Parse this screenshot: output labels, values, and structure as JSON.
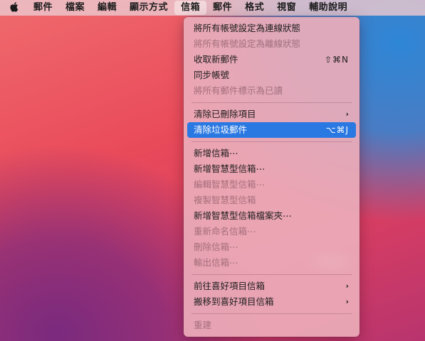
{
  "menubar": {
    "apple_icon": "apple-logo",
    "items": [
      {
        "label": "郵件"
      },
      {
        "label": "檔案"
      },
      {
        "label": "編輯"
      },
      {
        "label": "顯示方式"
      },
      {
        "label": "信箱",
        "active": true
      },
      {
        "label": "郵件"
      },
      {
        "label": "格式"
      },
      {
        "label": "視窗"
      },
      {
        "label": "輔助說明"
      }
    ]
  },
  "menu": {
    "items": [
      {
        "label": "將所有帳號設定為連線狀態",
        "enabled": true
      },
      {
        "label": "將所有帳號設定為離線狀態",
        "enabled": false
      },
      {
        "label": "收取新郵件",
        "enabled": true,
        "shortcut": "⇧⌘N"
      },
      {
        "label": "同步帳號",
        "enabled": true
      },
      {
        "label": "將所有郵件標示為已讀",
        "enabled": false
      },
      {
        "label": "清除已刪除項目",
        "enabled": true,
        "submenu": true
      },
      {
        "label": "清除垃圾郵件",
        "enabled": true,
        "shortcut": "⌥⌘J",
        "highlighted": true
      },
      {
        "label": "新增信箱⋯",
        "enabled": true
      },
      {
        "label": "新增智慧型信箱⋯",
        "enabled": true
      },
      {
        "label": "編輯智慧型信箱⋯",
        "enabled": false
      },
      {
        "label": "複製智慧型信箱",
        "enabled": false
      },
      {
        "label": "新增智慧型信箱檔案夾⋯",
        "enabled": true
      },
      {
        "label": "重新命名信箱⋯",
        "enabled": false
      },
      {
        "label": "刪除信箱⋯",
        "enabled": false
      },
      {
        "label": "輸出信箱⋯",
        "enabled": false
      },
      {
        "label": "前往喜好項目信箱",
        "enabled": true,
        "submenu": true
      },
      {
        "label": "搬移到喜好項目信箱",
        "enabled": true,
        "submenu": true
      },
      {
        "label": "重建",
        "enabled": false
      }
    ],
    "submenu_glyph": "›"
  },
  "colors": {
    "highlight": "#2a78e2",
    "menu_background": "#ecacba"
  }
}
